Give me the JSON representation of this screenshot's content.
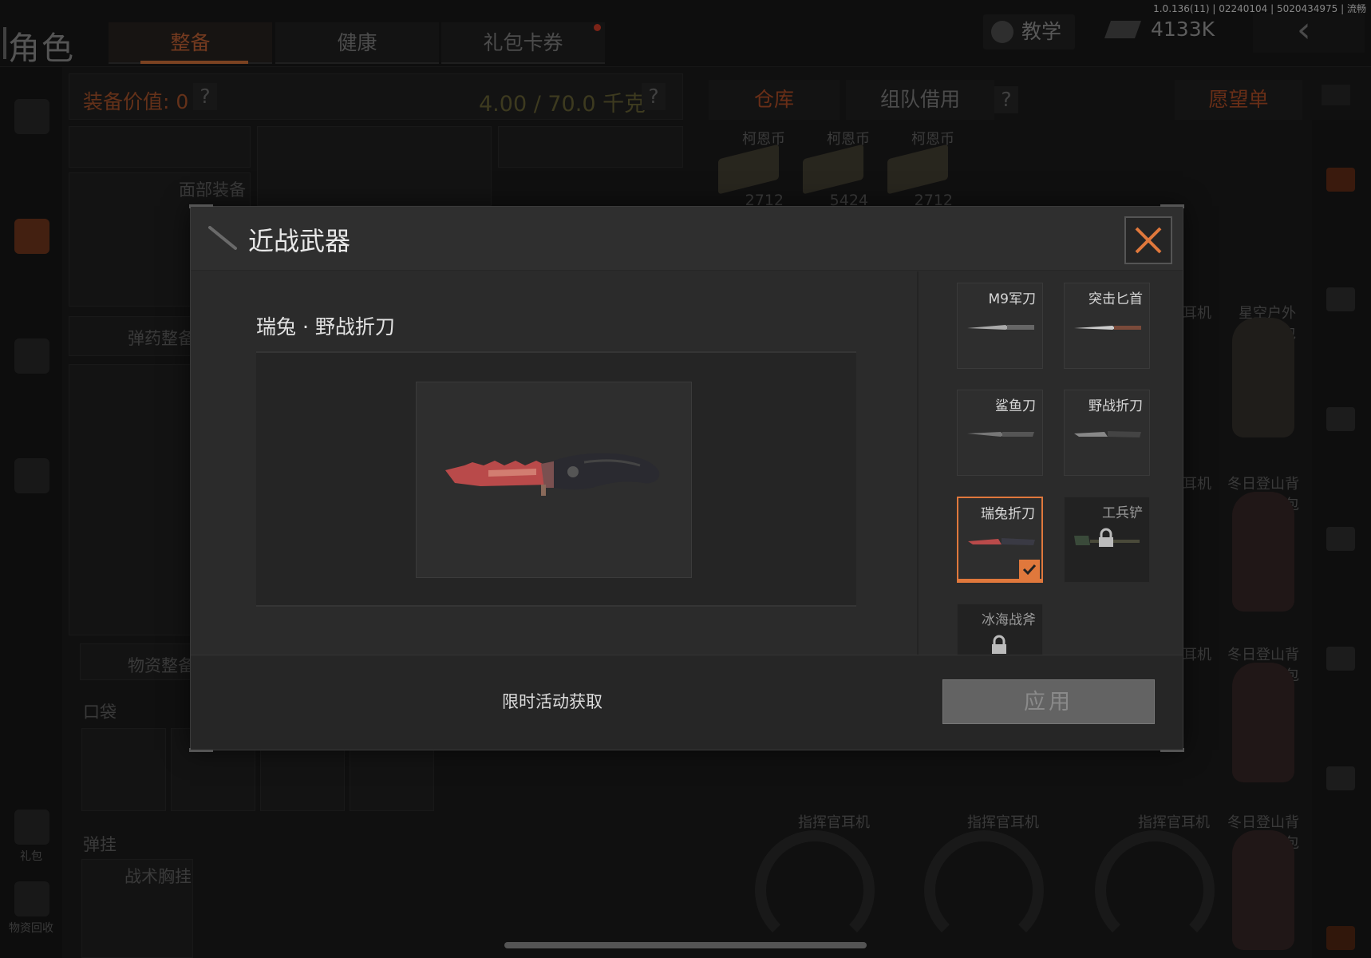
{
  "version_info": "1.0.136(11) | 02240104 | 5020434975 | 流畅",
  "page": {
    "title": "角色",
    "tabs": [
      {
        "label": "整备",
        "active": true
      },
      {
        "label": "健康",
        "active": false
      },
      {
        "label": "礼包卡券",
        "active": false
      }
    ],
    "teach_label": "教学",
    "money": "4133K",
    "equipment_value": "装备价值: 0",
    "weight": "4.00 / 70.0 千克",
    "face_equip_label": "面部装备",
    "ammo_label": "弹药整备",
    "supply_label": "物资整备",
    "pocket_label": "口袋",
    "rig_label": "弹挂",
    "tactical_rig_label": "战术胸挂",
    "gift_label": "礼包",
    "recycle_label": "物资回收",
    "right_tabs": {
      "warehouse": "仓库",
      "team_borrow": "组队借用",
      "wishlist": "愿望单"
    },
    "coins": [
      {
        "name": "柯恩币",
        "count": "2712"
      },
      {
        "name": "柯恩币",
        "count": "5424"
      },
      {
        "name": "柯恩币",
        "count": "2712"
      }
    ],
    "grid_items": {
      "headset": "耳机",
      "starry_pack": "星空户外包",
      "winter_pack": "冬日登山背包",
      "commander_headset": "指挥官耳机"
    }
  },
  "modal": {
    "title": "近战武器",
    "item_name": "瑞兔 · 野战折刀",
    "weapons": [
      {
        "label": "M9军刀",
        "state": "normal"
      },
      {
        "label": "突击匕首",
        "state": "normal"
      },
      {
        "label": "鲨鱼刀",
        "state": "normal"
      },
      {
        "label": "野战折刀",
        "state": "normal"
      },
      {
        "label": "瑞兔折刀",
        "state": "selected"
      },
      {
        "label": "工兵铲",
        "state": "locked"
      },
      {
        "label": "冰海战斧",
        "state": "locked"
      }
    ],
    "obtain_text": "限时活动获取",
    "apply_label": "应用"
  },
  "colors": {
    "accent": "#e0783c",
    "modal_bg": "#2b2b2b",
    "knife_blade": "#b94a4a"
  }
}
